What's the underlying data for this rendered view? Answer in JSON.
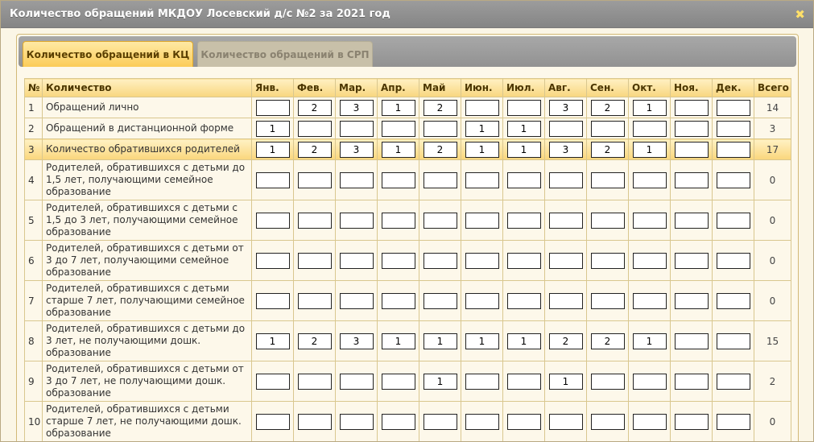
{
  "dialog": {
    "title": "Количество обращений МКДОУ Лосевский д/с №2 за 2021 год",
    "close_glyph": "✖"
  },
  "tabs": [
    {
      "label": "Количество обращений в КЦ",
      "active": true
    },
    {
      "label": "Количество обращений в СРП",
      "active": false
    }
  ],
  "table": {
    "headers": {
      "num": "№",
      "label": "Количество",
      "months": [
        "Янв.",
        "Фев.",
        "Мар.",
        "Апр.",
        "Май",
        "Июн.",
        "Июл.",
        "Авг.",
        "Сен.",
        "Окт.",
        "Ноя.",
        "Дек."
      ],
      "total": "Всего"
    },
    "rows": [
      {
        "num": "1",
        "label": "Обращений лично",
        "values": [
          "",
          "2",
          "3",
          "1",
          "2",
          "",
          "",
          "3",
          "2",
          "1",
          "",
          ""
        ],
        "total": "14",
        "highlight": false
      },
      {
        "num": "2",
        "label": "Обращений в дистанционной форме",
        "values": [
          "1",
          "",
          "",
          "",
          "",
          "1",
          "1",
          "",
          "",
          "",
          "",
          ""
        ],
        "total": "3",
        "highlight": false
      },
      {
        "num": "3",
        "label": "Количество обратившихся родителей",
        "values": [
          "1",
          "2",
          "3",
          "1",
          "2",
          "1",
          "1",
          "3",
          "2",
          "1",
          "",
          ""
        ],
        "total": "17",
        "highlight": true
      },
      {
        "num": "4",
        "label": "Родителей, обратившихся с детьми до 1,5 лет, получающими семейное образование",
        "values": [
          "",
          "",
          "",
          "",
          "",
          "",
          "",
          "",
          "",
          "",
          "",
          ""
        ],
        "total": "0",
        "highlight": false
      },
      {
        "num": "5",
        "label": "Родителей, обратившихся с детьми с 1,5 до 3 лет, получающими семейное образование",
        "values": [
          "",
          "",
          "",
          "",
          "",
          "",
          "",
          "",
          "",
          "",
          "",
          ""
        ],
        "total": "0",
        "highlight": false
      },
      {
        "num": "6",
        "label": "Родителей, обратившихся с детьми от 3 до 7 лет, получающими семейное образование",
        "values": [
          "",
          "",
          "",
          "",
          "",
          "",
          "",
          "",
          "",
          "",
          "",
          ""
        ],
        "total": "0",
        "highlight": false
      },
      {
        "num": "7",
        "label": "Родителей, обратившихся с детьми старше 7 лет, получающими семейное образование",
        "values": [
          "",
          "",
          "",
          "",
          "",
          "",
          "",
          "",
          "",
          "",
          "",
          ""
        ],
        "total": "0",
        "highlight": false
      },
      {
        "num": "8",
        "label": "Родителей, обратившихся с детьми до 3 лет, не получающими дошк. образование",
        "values": [
          "1",
          "2",
          "3",
          "1",
          "1",
          "1",
          "1",
          "2",
          "2",
          "1",
          "",
          ""
        ],
        "total": "15",
        "highlight": false
      },
      {
        "num": "9",
        "label": "Родителей, обратившихся с детьми от 3 до 7 лет, не получающими дошк. образование",
        "values": [
          "",
          "",
          "",
          "",
          "1",
          "",
          "",
          "1",
          "",
          "",
          "",
          ""
        ],
        "total": "2",
        "highlight": false
      },
      {
        "num": "10",
        "label": "Родителей, обратившихся с детьми старше 7 лет, не получающими дошк. образование",
        "values": [
          "",
          "",
          "",
          "",
          "",
          "",
          "",
          "",
          "",
          "",
          "",
          ""
        ],
        "total": "0",
        "highlight": false
      }
    ]
  }
}
